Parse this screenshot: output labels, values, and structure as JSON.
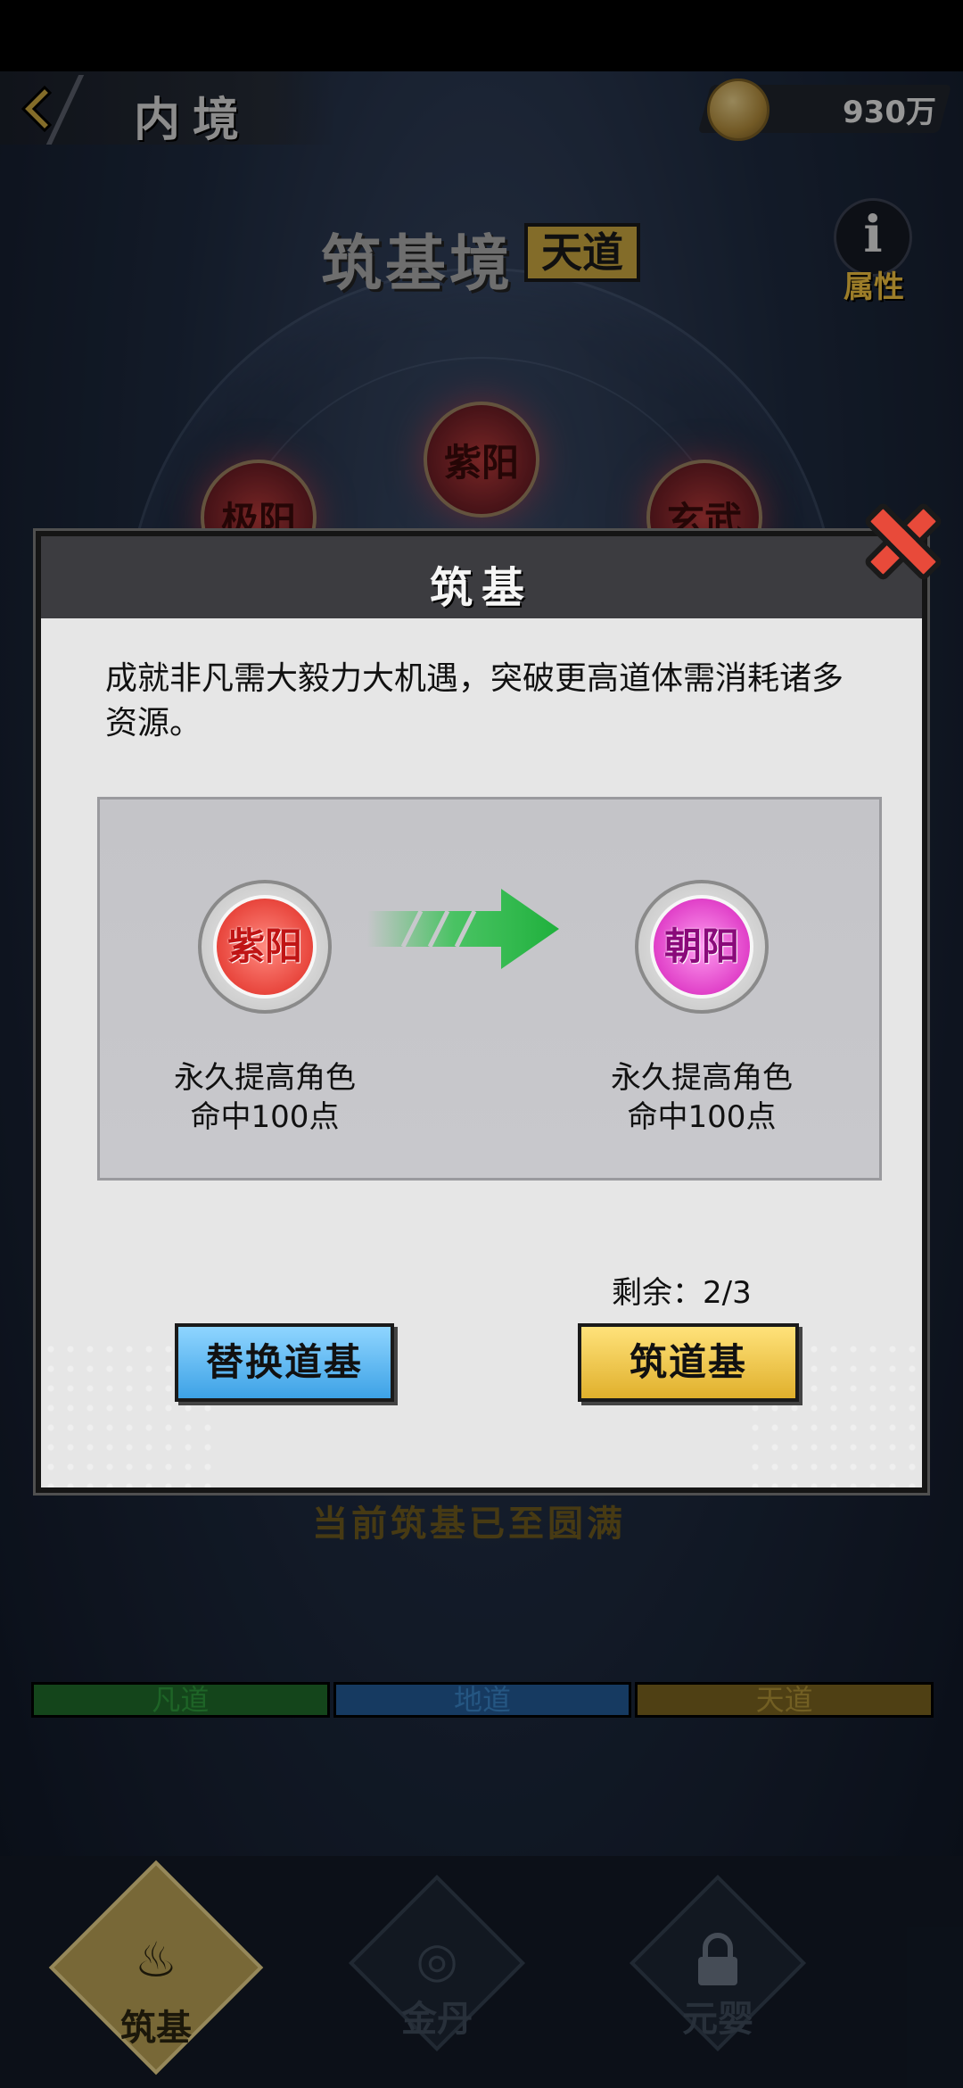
{
  "header": {
    "title": "内境",
    "back_icon": "back-chevron-icon",
    "currency_icon": "coin-icon",
    "currency_value": "930万"
  },
  "realm": {
    "name": "筑基境",
    "tier_badge": "天道",
    "attr_label": "属性",
    "attr_icon": "info-icon"
  },
  "background_orbs": [
    "极阳",
    "紫阳",
    "玄武"
  ],
  "dialog": {
    "title": "筑基",
    "description": "成就非凡需大毅力大机遇，突破更高道体需消耗诸多资源。",
    "from": {
      "name": "紫阳",
      "color": "#e8453c",
      "bonus_line1": "永久提高角色",
      "bonus_line2": "命中100点"
    },
    "to": {
      "name": "朝阳",
      "color": "#e040c8",
      "bonus_line1": "永久提高角色",
      "bonus_line2": "命中100点"
    },
    "arrow_icon": "green-arrow-right-icon",
    "remaining": "剩余：2/3",
    "replace_button": "替换道基",
    "build_button": "筑道基",
    "close_icon": "close-x-icon"
  },
  "faded_status": "当前筑基已至圆满",
  "tiers": [
    "凡道",
    "地道",
    "天道"
  ],
  "tier_colors": {
    "fan": "#1f6b2a",
    "di": "#225a95",
    "tian": "#7a6320"
  },
  "bottom_nav": [
    {
      "label": "筑基",
      "icon": "flame-lotus-icon",
      "active": true
    },
    {
      "label": "金丹",
      "icon": "spiral-icon",
      "active": false
    },
    {
      "label": "元婴",
      "icon": "lock-icon",
      "active": false
    }
  ]
}
